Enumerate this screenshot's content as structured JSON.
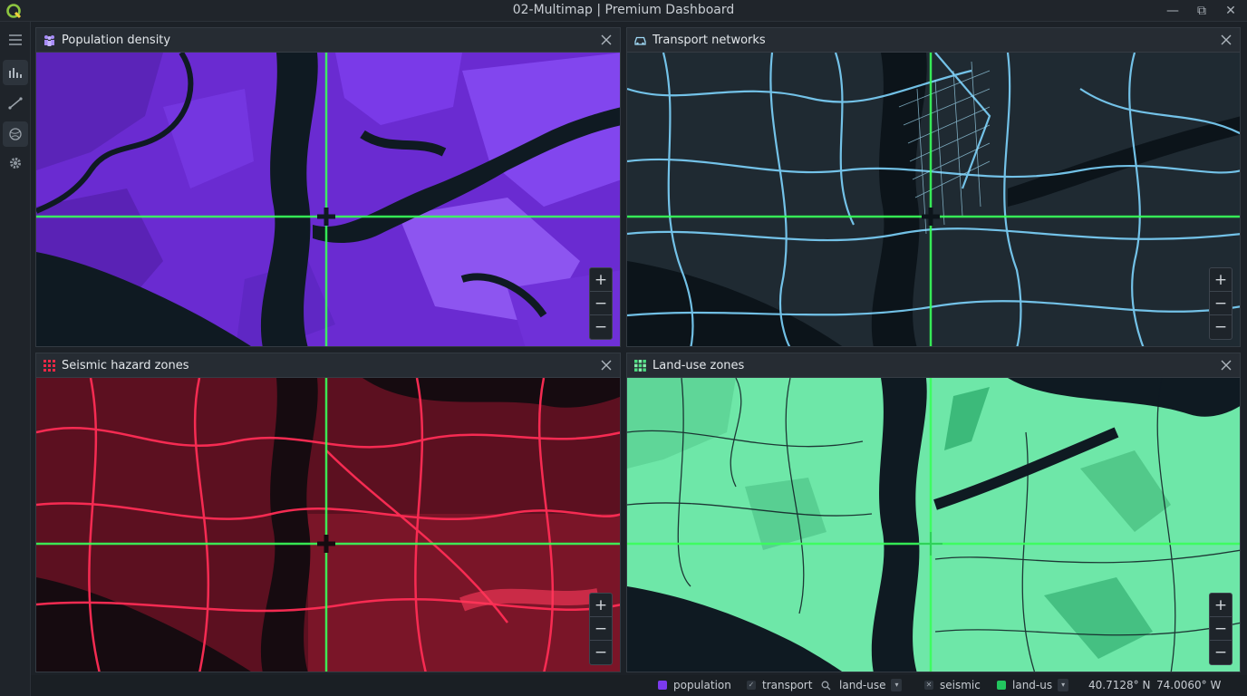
{
  "window": {
    "title": "02-Multimap | Premium Dashboard",
    "minimize": "—",
    "restore": "⧉",
    "close": "✕"
  },
  "sidebar": {
    "items": [
      {
        "name": "menu",
        "icon": "hamburger-icon"
      },
      {
        "name": "charts",
        "icon": "bar-chart-icon"
      },
      {
        "name": "measure",
        "icon": "line-tool-icon"
      },
      {
        "name": "layers",
        "icon": "globe-icon"
      },
      {
        "name": "settings",
        "icon": "gear-icon"
      }
    ]
  },
  "panels": [
    {
      "title": "Population density",
      "icon": "people-icon",
      "accent": "#8b5cf6"
    },
    {
      "title": "Transport networks",
      "icon": "car-icon",
      "accent": "#7dd3fc"
    },
    {
      "title": "Seismic hazard zones",
      "icon": "grid-icon",
      "accent": "#ef2745"
    },
    {
      "title": "Land-use zones",
      "icon": "tiles-icon",
      "accent": "#6ee7a8"
    }
  ],
  "zoom": {
    "in": "+",
    "out1": "−",
    "out2": "−"
  },
  "status": {
    "layers": [
      {
        "label": "population",
        "color": "#7c3aed"
      },
      {
        "label": "transport",
        "color": "#9aa2aa"
      },
      {
        "label": "land-use",
        "color": "#9aa2aa"
      },
      {
        "label": "seismic",
        "color": "#9aa2aa"
      },
      {
        "label": "land-us",
        "color": "#22c55e"
      }
    ],
    "lat": "40.7128° N",
    "lon": "74.0060° W"
  },
  "colors": {
    "crosshair": "#39ff5a",
    "water": "#0f1a22"
  }
}
